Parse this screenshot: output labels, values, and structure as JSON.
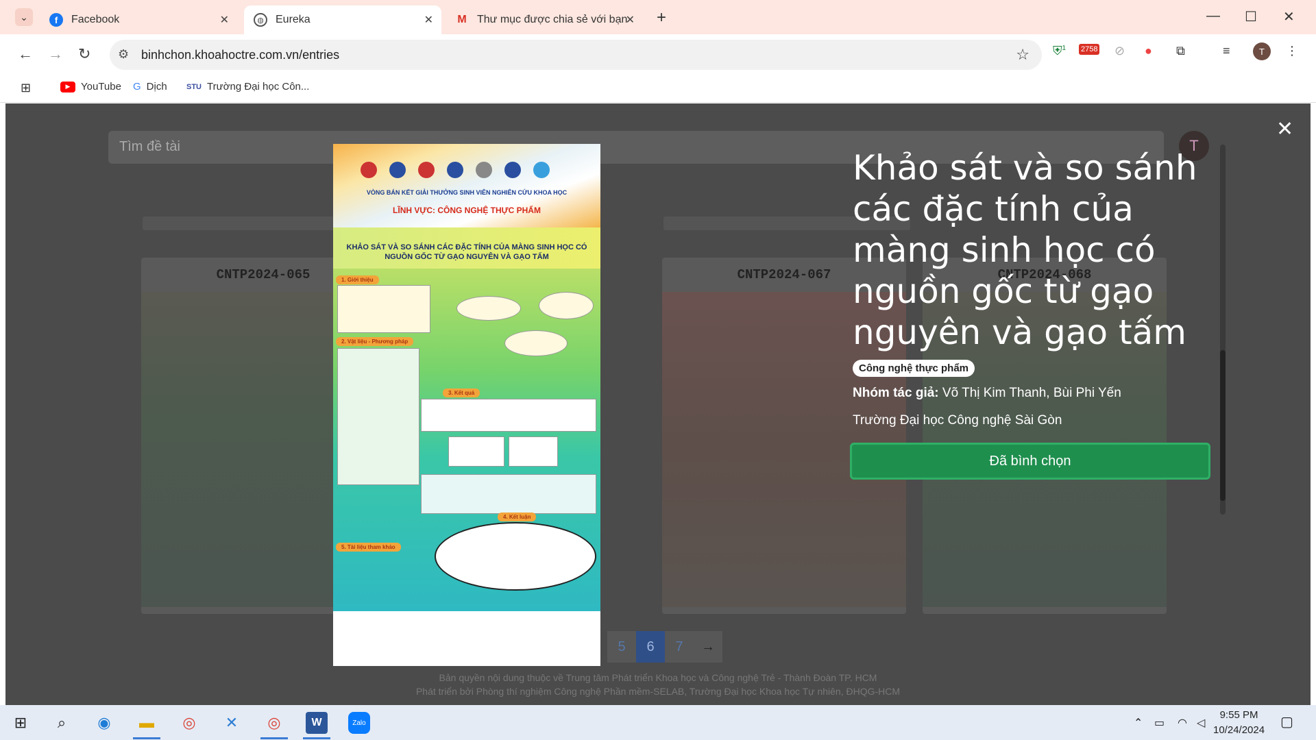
{
  "browser": {
    "tabs": [
      {
        "label": "Facebook",
        "icon": "facebook-icon"
      },
      {
        "label": "Eureka",
        "icon": "globe-icon"
      },
      {
        "label": "Thư mục được chia sẻ với bạn:",
        "icon": "gmail-icon"
      }
    ],
    "url": "binhchon.khoahoctre.com.vn/entries",
    "bookmarks": [
      {
        "label": "YouTube"
      },
      {
        "label": "Dịch"
      },
      {
        "label": "Trường Đại học Côn..."
      }
    ],
    "extension_badges": {
      "shield": "1",
      "counter": "2758"
    },
    "profile_initial": "T"
  },
  "page": {
    "search_placeholder": "Tìm đề tài",
    "avatar_initial": "T",
    "cards": [
      {
        "code": "CNTP2024-065"
      },
      {
        "code": "CNTP2024-067"
      },
      {
        "code": "CNTP2024-068"
      }
    ],
    "pager": {
      "pages": [
        "5",
        "6",
        "7"
      ],
      "current": "6",
      "next": "→"
    },
    "footer": [
      "Bản quyền nội dung thuộc về Trung tâm Phát triển Khoa học và Công nghệ Trẻ - Thành Đoàn TP. HCM",
      "Phát triển bởi Phòng thí nghiệm Công nghệ Phần mềm-SELAB, Trường Đại học Khoa học Tự nhiên, ĐHQG-HCM"
    ]
  },
  "modal": {
    "title": "Khảo sát và so sánh các đặc tính của màng sinh học có nguồn gốc từ gạo nguyên và gạo tấm",
    "category": "Công nghệ thực phẩm",
    "authors_label": "Nhóm tác giả:",
    "authors": "Võ Thị Kim Thanh, Bùi Phi Yến",
    "school": "Trường Đại học Công nghệ Sài Gòn",
    "vote_button": "Đã bình chọn",
    "close": "✕",
    "poster": {
      "heading_round": "VÒNG BÁN KẾT GIẢI THƯỞNG SINH VIÊN NGHIÊN CỨU KHOA HỌC",
      "heading_field": "LĨNH VỰC: CÔNG NGHỆ THỰC PHẨM",
      "title": "KHẢO SÁT VÀ SO SÁNH CÁC ĐẶC TÍNH CỦA MÀNG SINH HỌC CÓ NGUỒN GỐC TỪ GẠO NGUYÊN VÀ GẠO TẤM",
      "sections": [
        "1. Giới thiệu",
        "2. Vật liệu - Phương pháp",
        "3. Kết quả",
        "4. Kết luận",
        "5. Tài liệu tham khảo"
      ]
    }
  },
  "taskbar": {
    "time": "9:55 PM",
    "date": "10/24/2024"
  }
}
